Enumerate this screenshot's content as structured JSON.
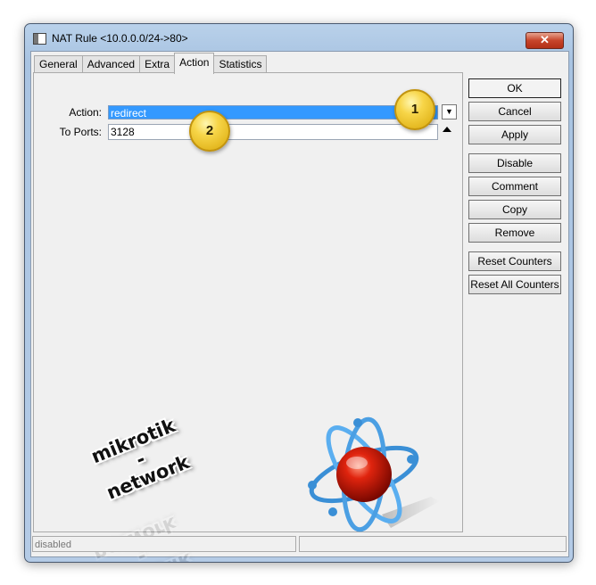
{
  "window": {
    "title": "NAT Rule <10.0.0.0/24->80>",
    "close_label": "✕"
  },
  "tabs": [
    {
      "label": "General",
      "active": false
    },
    {
      "label": "Advanced",
      "active": false
    },
    {
      "label": "Extra",
      "active": false
    },
    {
      "label": "Action",
      "active": true
    },
    {
      "label": "Statistics",
      "active": false
    }
  ],
  "form": {
    "action_label": "Action:",
    "action_value": "redirect",
    "to_ports_label": "To Ports:",
    "to_ports_value": "3128"
  },
  "callouts": [
    "1",
    "2"
  ],
  "buttons": {
    "ok": "OK",
    "cancel": "Cancel",
    "apply": "Apply",
    "disable": "Disable",
    "comment": "Comment",
    "copy": "Copy",
    "remove": "Remove",
    "reset_counters": "Reset Counters",
    "reset_all_counters": "Reset All Counters"
  },
  "status": {
    "left": "disabled",
    "right": ""
  },
  "watermark": {
    "line1": "mikrotik",
    "line2": "-",
    "line3": "network"
  },
  "icons": {
    "window": "window-icon",
    "dropdown": "dropdown-arrow-icon",
    "remove_field": "up-arrow-icon",
    "atom": "atom-icon"
  },
  "colors": {
    "selection": "#3399ff",
    "close_button": "#c7442a",
    "callout": "#f7d548",
    "atom_orbit": "#3a8fd6",
    "atom_core": "#cc1a0a"
  }
}
